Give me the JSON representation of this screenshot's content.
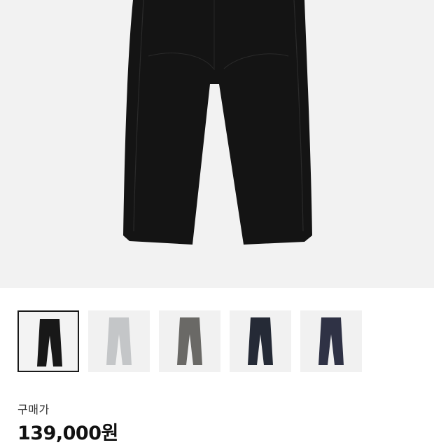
{
  "product": {
    "main_image": {
      "icon": "pants-image",
      "color": "#141414"
    },
    "thumbnails": [
      {
        "name": "black",
        "color": "#181818",
        "selected": true
      },
      {
        "name": "light-gray",
        "color": "#c4c6c8",
        "selected": false
      },
      {
        "name": "charcoal-gray",
        "color": "#6a6966",
        "selected": false
      },
      {
        "name": "navy",
        "color": "#252a36",
        "selected": false
      },
      {
        "name": "dark-navy",
        "color": "#2f3245",
        "selected": false
      }
    ],
    "price_label": "구매가",
    "price_value": "139,000원"
  }
}
